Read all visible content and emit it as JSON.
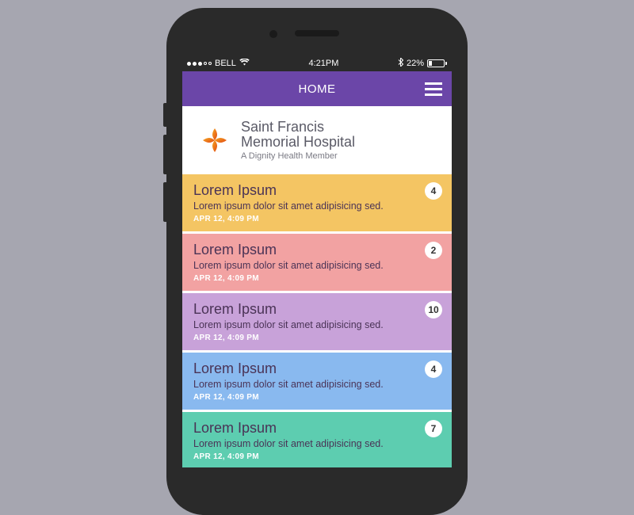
{
  "status": {
    "carrier": "BELL",
    "time": "4:21PM",
    "battery_pct": "22%"
  },
  "header": {
    "title": "HOME"
  },
  "brand": {
    "name_line1": "Saint Francis",
    "name_line2": "Memorial Hospital",
    "subtitle": "A Dignity Health Member"
  },
  "items": [
    {
      "title": "Lorem Ipsum",
      "subtitle": "Lorem ipsum dolor sit amet adipisicing sed.",
      "time": "APR 12, 4:09 PM",
      "count": "4",
      "bg": "#f4c563"
    },
    {
      "title": "Lorem Ipsum",
      "subtitle": "Lorem ipsum dolor sit amet adipisicing sed.",
      "time": "APR 12, 4:09 PM",
      "count": "2",
      "bg": "#f2a2a2"
    },
    {
      "title": "Lorem Ipsum",
      "subtitle": "Lorem ipsum dolor sit amet adipisicing sed.",
      "time": "APR 12, 4:09 PM",
      "count": "10",
      "bg": "#c8a2d9"
    },
    {
      "title": "Lorem Ipsum",
      "subtitle": "Lorem ipsum dolor sit amet adipisicing sed.",
      "time": "APR 12, 4:09 PM",
      "count": "4",
      "bg": "#89b9ef"
    },
    {
      "title": "Lorem Ipsum",
      "subtitle": "Lorem ipsum dolor sit amet adipisicing sed.",
      "time": "APR 12, 4:09 PM",
      "count": "7",
      "bg": "#5dcdb0"
    }
  ]
}
